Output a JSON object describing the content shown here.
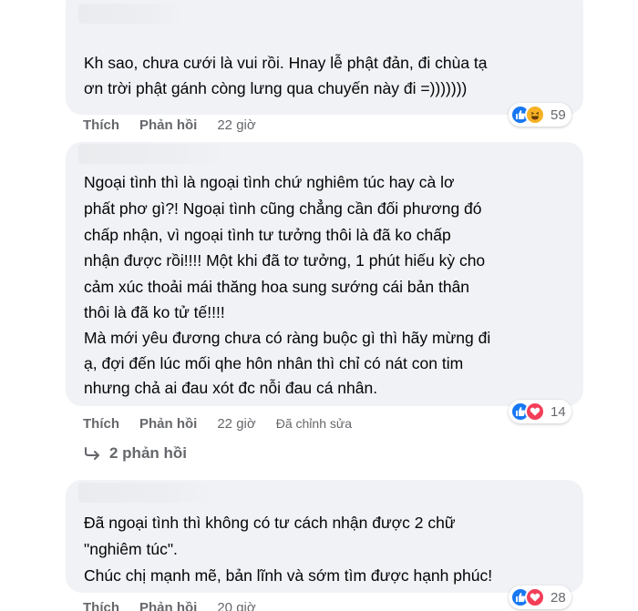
{
  "colors": {
    "bubble_bg": "#f0f2f5",
    "text": "#050505",
    "secondary_text": "#65676b",
    "like_blue": "#1877f2",
    "love_red": "#f33e58",
    "haha_yellow": "#f7b125"
  },
  "comments": [
    {
      "text_lines": [
        "Kh sao, chưa cưới là vui rồi. Hnay lễ phật đản, đi chùa tạ",
        "ơn trời phật gánh còng lưng qua chuyến này đi =)))))))"
      ],
      "actions": {
        "like": "Thích",
        "reply": "Phản hồi",
        "time": "22 giờ"
      },
      "reactions": {
        "icons": [
          "like-icon",
          "haha-icon"
        ],
        "count": "59"
      }
    },
    {
      "text_lines": [
        "Ngoại tình thì là ngoại tình chứ nghiêm túc hay cà lơ",
        "phất phơ gì?! Ngoại tình cũng chẳng cần đối phương đó",
        "chấp nhận, vì ngoại tình tư tưởng thôi là đã ko chấp",
        "nhận được rồi!!!! Một khi đã tơ tưởng, 1 phút hiếu kỳ cho",
        "cảm xúc thoải mái thăng hoa sung sướng cái bản thân",
        "thôi là đã ko tử tế!!!!",
        "Mà mới yêu đương chưa có ràng buộc gì thì hãy mừng đi",
        "ạ, đợi đến lúc mối qhe hôn nhân thì chỉ có nát con tim",
        "nhưng chả ai đau xót đc nỗi đau cá nhân."
      ],
      "actions": {
        "like": "Thích",
        "reply": "Phản hồi",
        "time": "22 giờ",
        "edited": "Đã chỉnh sửa"
      },
      "reactions": {
        "icons": [
          "like-icon",
          "love-icon"
        ],
        "count": "14"
      },
      "replies_label": "2 phản hồi"
    },
    {
      "text_lines": [
        "Đã ngoại tình thì không có tư cách nhận được 2 chữ",
        "\"nghiêm túc\".",
        "Chúc chị mạnh mẽ, bản lĩnh và sớm tìm được hạnh phúc!"
      ],
      "actions": {
        "like": "Thích",
        "reply": "Phản hồi",
        "time": "20 giờ"
      },
      "reactions": {
        "icons": [
          "like-icon",
          "love-icon"
        ],
        "count": "28"
      }
    }
  ]
}
